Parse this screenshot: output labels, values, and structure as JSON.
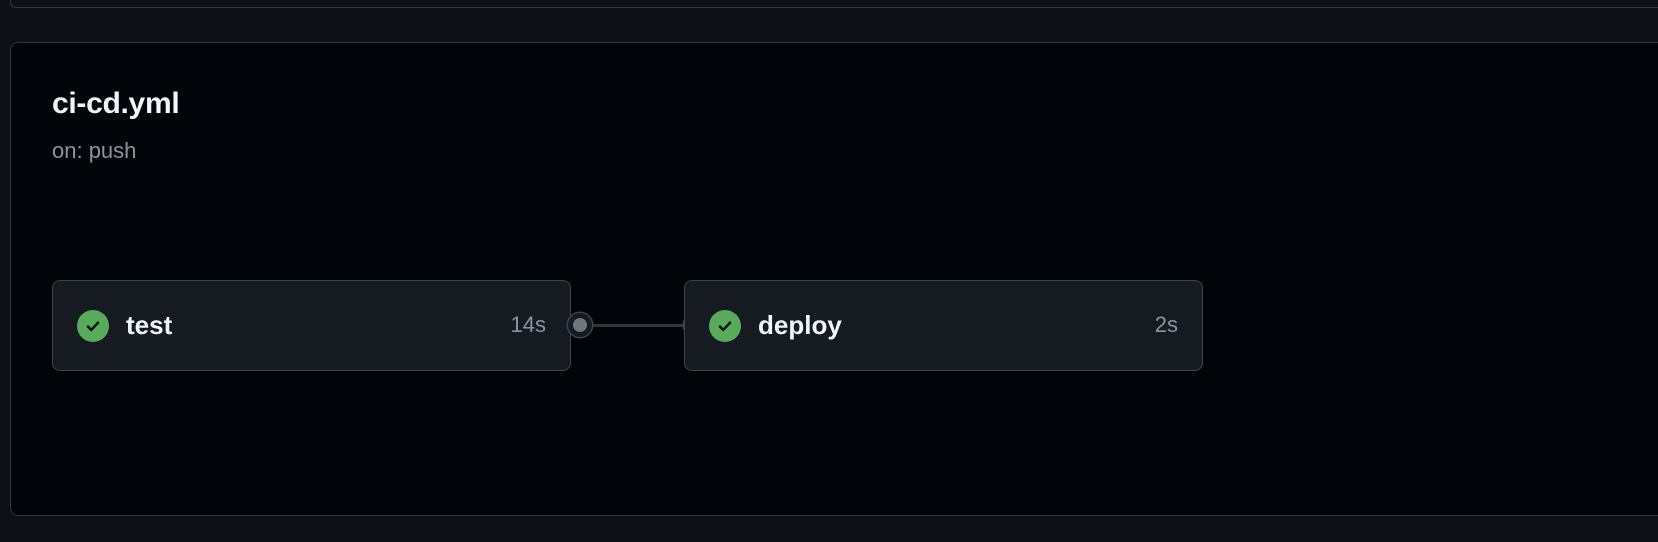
{
  "workflow": {
    "title": "ci-cd.yml",
    "trigger": "on: push"
  },
  "jobs": [
    {
      "name": "test",
      "duration": "14s",
      "status": "success",
      "status_icon": "check-circle-icon"
    },
    {
      "name": "deploy",
      "duration": "2s",
      "status": "success",
      "status_icon": "check-circle-icon"
    }
  ],
  "colors": {
    "background": "#0d1117",
    "panel_background": "#010409",
    "card_background": "#161b22",
    "border": "#30363d",
    "success": "#57ab5a",
    "text_primary": "#f0f6fc",
    "text_muted": "#8b949e"
  }
}
